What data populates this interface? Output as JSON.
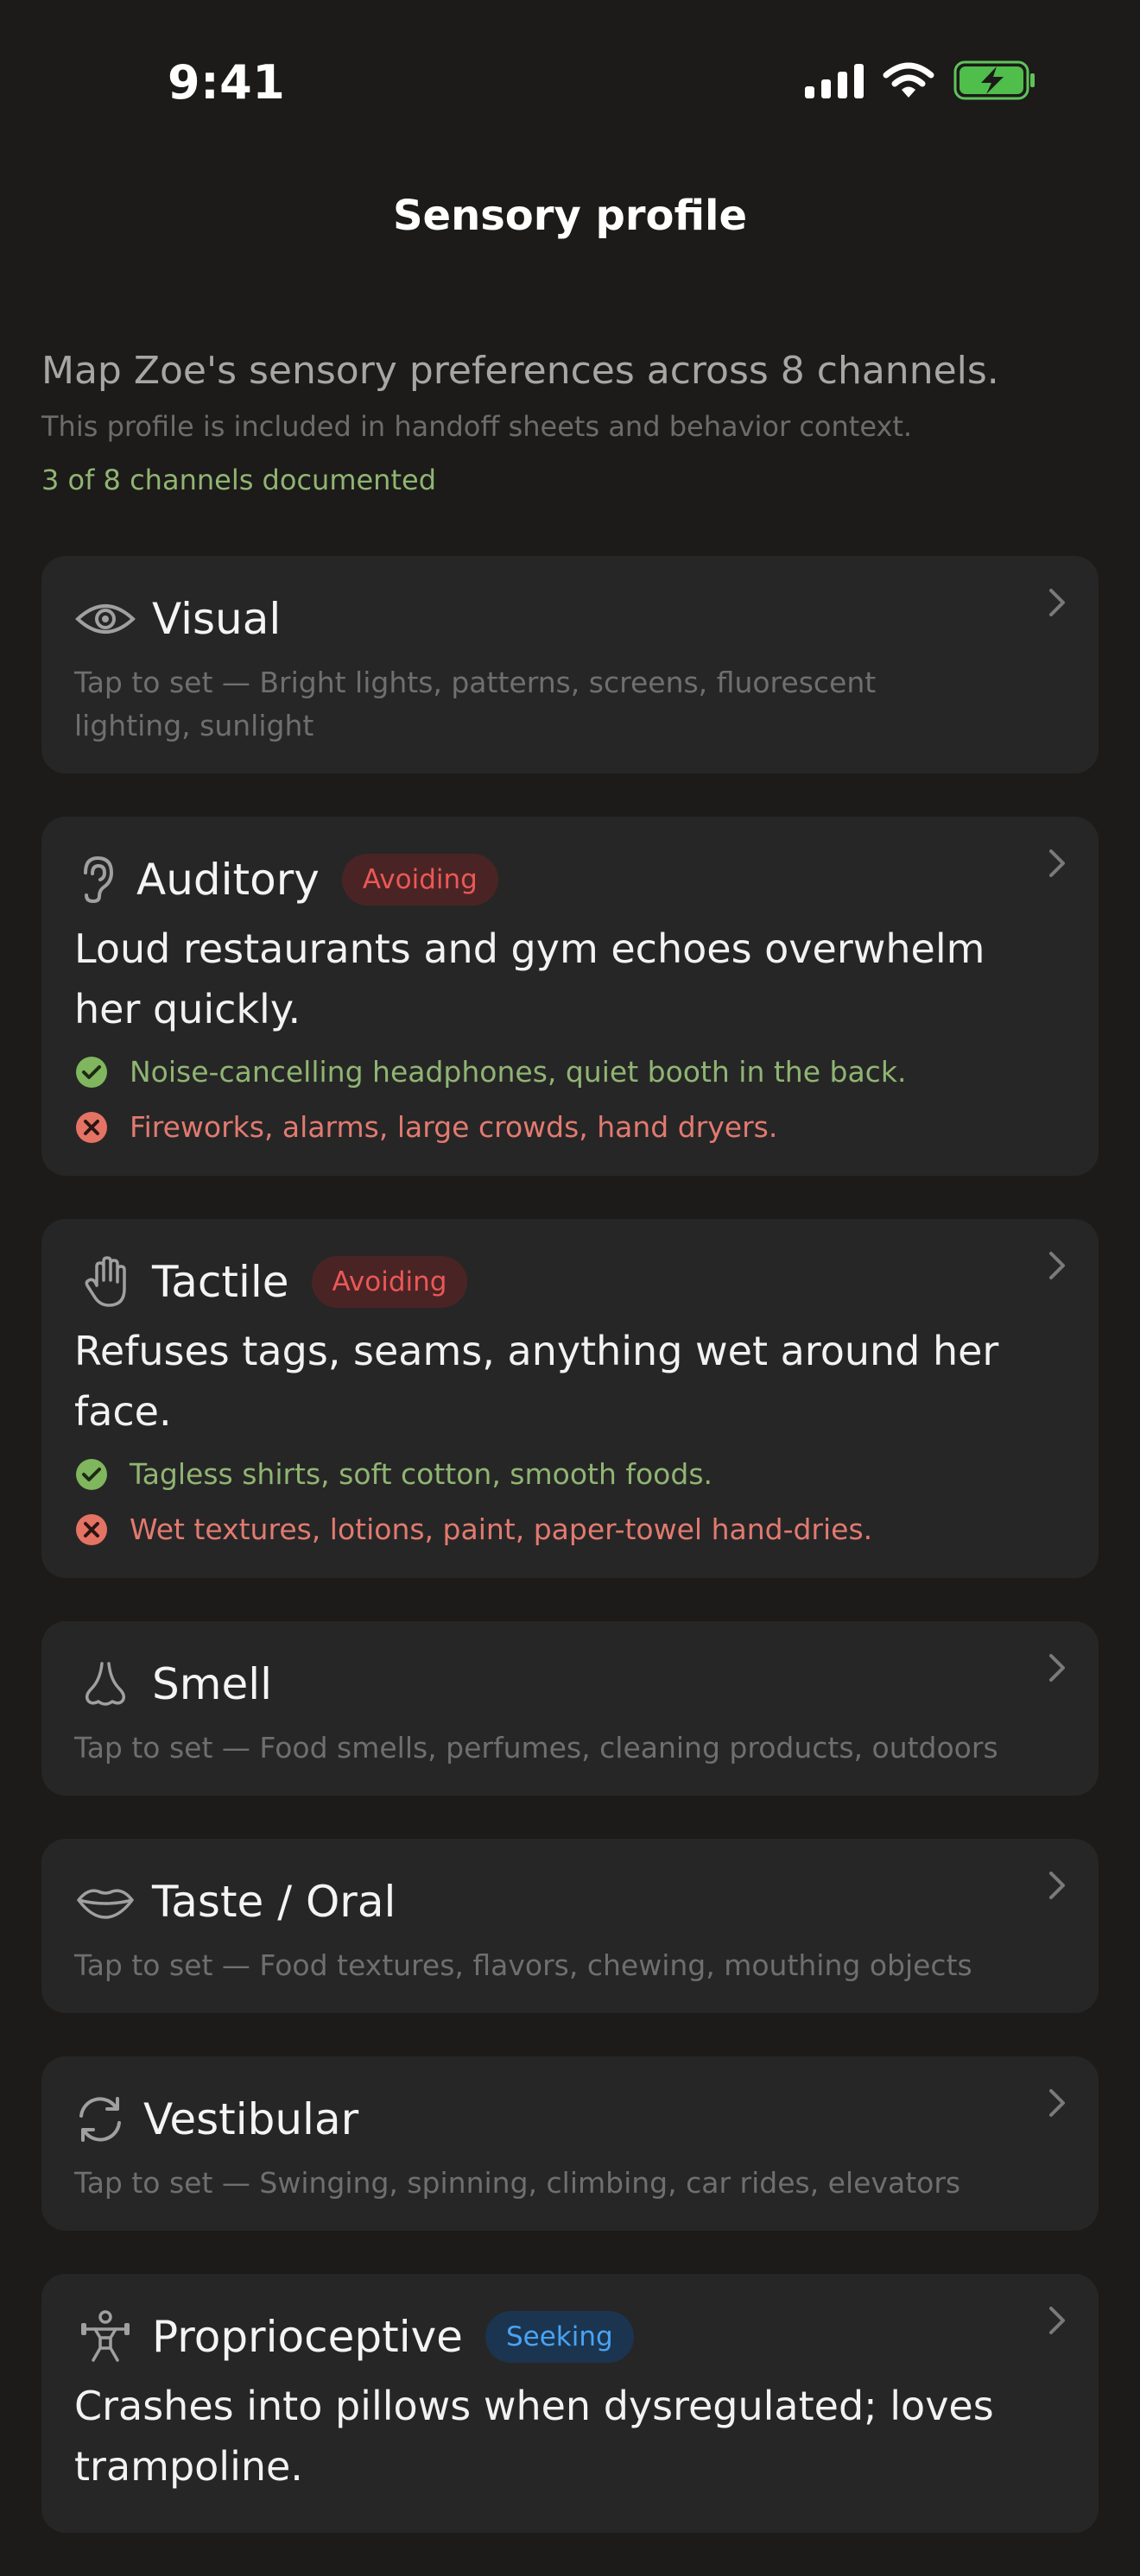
{
  "status": {
    "time": "9:41"
  },
  "nav": {
    "title": "Sensory profile"
  },
  "intro": {
    "title": "Map Zoe's sensory preferences across 8 channels.",
    "subtitle": "This profile is included in handoff sheets and behavior context.",
    "count": "3 of 8 channels documented"
  },
  "colors": {
    "background": "#1c1b19",
    "card": "#272626",
    "positive": "#8fb573",
    "negative": "#e27a70",
    "avoiding_badge": "#ec5757",
    "seeking_badge": "#4aa3f2"
  },
  "channels": [
    {
      "id": "visual",
      "icon": "eye-icon",
      "title": "Visual",
      "placeholder": "Tap to set — Bright lights, patterns, screens, fluorescent lighting, sunlight"
    },
    {
      "id": "auditory",
      "icon": "ear-icon",
      "title": "Auditory",
      "badge": "Avoiding",
      "note": "Loud restaurants and gym echoes overwhelm her quickly.",
      "helps": "Noise-cancelling headphones, quiet booth in the back.",
      "triggers": "Fireworks, alarms, large crowds, hand dryers."
    },
    {
      "id": "tactile",
      "icon": "hand-icon",
      "title": "Tactile",
      "badge": "Avoiding",
      "note": "Refuses tags, seams, anything wet around her face.",
      "helps": "Tagless shirts, soft cotton, smooth foods.",
      "triggers": "Wet textures, lotions, paint, paper-towel hand-dries."
    },
    {
      "id": "smell",
      "icon": "nose-icon",
      "title": "Smell",
      "placeholder": "Tap to set — Food smells, perfumes, cleaning products, outdoors"
    },
    {
      "id": "taste",
      "icon": "lips-icon",
      "title": "Taste / Oral",
      "placeholder": "Tap to set — Food textures, flavors, chewing, mouthing objects"
    },
    {
      "id": "vestibular",
      "icon": "rotate-icon",
      "title": "Vestibular",
      "placeholder": "Tap to set — Swinging, spinning, climbing, car rides, elevators"
    },
    {
      "id": "proprioceptive",
      "icon": "weightlifter-icon",
      "title": "Proprioceptive",
      "badge": "Seeking",
      "note": "Crashes into pillows when dysregulated; loves trampoline."
    }
  ]
}
